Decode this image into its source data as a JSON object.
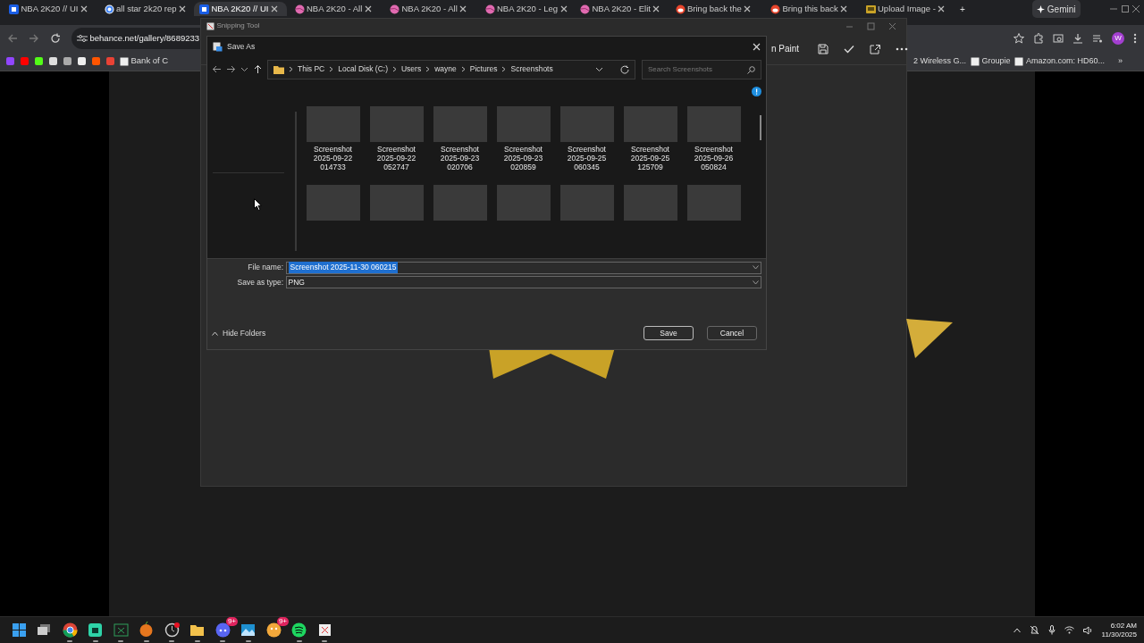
{
  "browser": {
    "tabs": [
      {
        "title": "NBA 2K20 // UI",
        "kind": "behance",
        "selected": false
      },
      {
        "title": "all star 2k20 rep",
        "kind": "google",
        "selected": false
      },
      {
        "title": "NBA 2K20 // UI",
        "kind": "behance",
        "selected": true
      },
      {
        "title": "NBA 2K20 - All",
        "kind": "dribbble",
        "selected": false
      },
      {
        "title": "NBA 2K20 - All",
        "kind": "dribbble",
        "selected": false
      },
      {
        "title": "NBA 2K20 - Leg",
        "kind": "dribbble",
        "selected": false
      },
      {
        "title": "NBA 2K20 - Elit",
        "kind": "dribbble",
        "selected": false
      },
      {
        "title": "Bring back the",
        "kind": "reddit",
        "selected": false
      },
      {
        "title": "Bring this back",
        "kind": "reddit",
        "selected": false
      },
      {
        "title": "Upload Image -",
        "kind": "upload",
        "selected": false
      }
    ],
    "new_tab": "+",
    "gemini": "Gemini",
    "address": "behance.net/gallery/8689233",
    "profile": "W",
    "bookmarks_left": [
      {
        "label": "Bank of C"
      }
    ],
    "bookmarks_right": [
      {
        "label": "2 Wireless G..."
      },
      {
        "label": "Groupie"
      },
      {
        "label": "Amazon.com: HD60..."
      }
    ],
    "overflow": "»"
  },
  "snipping_tool": {
    "title": "Snipping Tool",
    "open_in_paint": "n Paint"
  },
  "save_as": {
    "title": "Save As",
    "path": [
      "This PC",
      "Local Disk (C:)",
      "Users",
      "wayne",
      "Pictures",
      "Screenshots"
    ],
    "search": {
      "placeholder": "Search Screenshots"
    },
    "files": [
      {
        "name_lines": [
          "Screenshot",
          "2025-09-22",
          "014733"
        ]
      },
      {
        "name_lines": [
          "Screenshot",
          "2025-09-22",
          "052747"
        ]
      },
      {
        "name_lines": [
          "Screenshot",
          "2025-09-23",
          "020706"
        ]
      },
      {
        "name_lines": [
          "Screenshot",
          "2025-09-23",
          "020859"
        ]
      },
      {
        "name_lines": [
          "Screenshot",
          "2025-09-25",
          "060345"
        ]
      },
      {
        "name_lines": [
          "Screenshot",
          "2025-09-25",
          "125709"
        ]
      },
      {
        "name_lines": [
          "Screenshot",
          "2025-09-26",
          "050824"
        ]
      }
    ],
    "file_name": {
      "label": "File name:",
      "value": "Screenshot 2025-11-30 060215"
    },
    "save_type": {
      "label": "Save as type:",
      "value": "PNG"
    },
    "hide_folders": "Hide Folders",
    "buttons": [
      {
        "label": "Save",
        "default": true
      },
      {
        "label": "Cancel",
        "default": false
      }
    ]
  },
  "taskbar": {
    "apps": [
      {
        "kind": "start",
        "running": false
      },
      {
        "kind": "taskview",
        "running": false
      },
      {
        "kind": "chrome",
        "running": true
      },
      {
        "kind": "green",
        "running": true
      },
      {
        "kind": "xbox",
        "running": true
      },
      {
        "kind": "fruit",
        "running": true
      },
      {
        "kind": "clock",
        "running": true
      },
      {
        "kind": "folder",
        "running": true
      },
      {
        "kind": "discord",
        "running": true,
        "badge": "9+"
      },
      {
        "kind": "photos",
        "running": true
      },
      {
        "kind": "orange",
        "running": false,
        "badge": "9+"
      },
      {
        "kind": "spotify",
        "running": true
      },
      {
        "kind": "snip",
        "running": true
      }
    ],
    "time": "6:02 AM",
    "date": "11/30/2025"
  }
}
